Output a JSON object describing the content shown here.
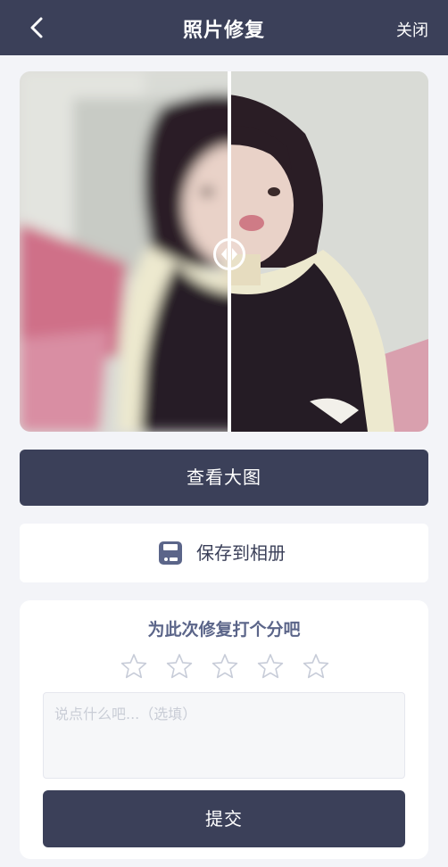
{
  "header": {
    "title": "照片修复",
    "close_label": "关闭"
  },
  "compare": {
    "handle_position": 0.51
  },
  "actions": {
    "view_large_label": "查看大图",
    "save_label": "保存到相册"
  },
  "rating": {
    "prompt": "为此次修复打个分吧",
    "max_stars": 5,
    "selected_stars": 0,
    "comment_placeholder": "说点什么吧...（选填）",
    "comment_value": "",
    "submit_label": "提交"
  },
  "colors": {
    "primary": "#3b4059",
    "accent_text": "#5b6589",
    "background": "#f3f4f8"
  }
}
